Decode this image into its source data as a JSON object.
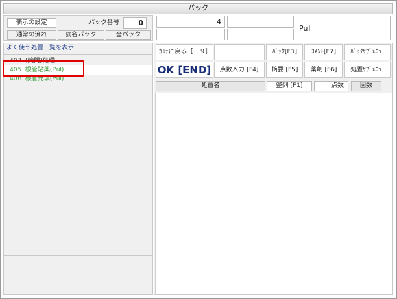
{
  "window": {
    "title": "パック"
  },
  "header_left": {
    "settings_button": "表示の設定",
    "pack_number_label": "パック番号",
    "pack_number_value": "0",
    "normal_flow_button": "通常の流れ",
    "disease_pack_button": "病名パック",
    "all_pack_button": "全パック"
  },
  "header_right": {
    "count_value": "4",
    "field2": "",
    "field3": "",
    "field4": "",
    "pul_label": "Pul"
  },
  "list": {
    "title": "よく使う処置一覧を表示",
    "items": [
      {
        "code": "407",
        "name": "(簡間)処理"
      },
      {
        "code": "405",
        "name": "根管貼薬(Pul)"
      },
      {
        "code": "406",
        "name": "根管充填(Pul)"
      }
    ],
    "highlight_color": "#e00000"
  },
  "commands": {
    "back_to_karte": "ｶﾙﾃに戻る［Ｆ９］",
    "pack": "ﾊﾟｯｸ[F3]",
    "comment": "ｺﾒﾝﾄ[F7]",
    "pack_sub_menu": "ﾊﾟｯｸｻﾌﾞﾒﾆｭｰ",
    "ok_end": "OK [END]",
    "points_input": "点数入力 [F4]",
    "summary": "摘要 [F5]",
    "medicine": "薬剤 [F6]",
    "treatment_sub_menu": "処置ｻﾌﾞﾒﾆｭｰ"
  },
  "table": {
    "col_name": "処置名",
    "sort_button": "整列 [F1]",
    "col_points": "点数",
    "col_count": "回数"
  }
}
